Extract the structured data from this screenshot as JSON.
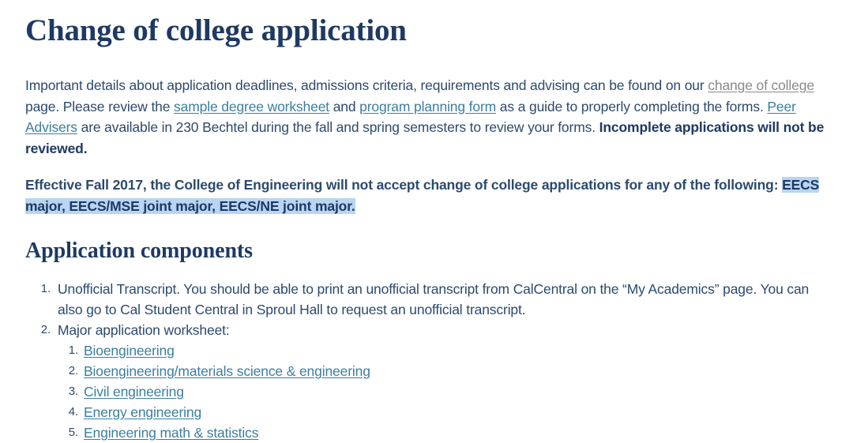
{
  "page": {
    "title": "Change of college application",
    "section_heading": "Application components"
  },
  "intro": {
    "part1": "Important details about application deadlines, admissions criteria, requirements and advising can be found on our ",
    "link_change_of_college": "change of college",
    "part2": " page. Please review the ",
    "link_sample_worksheet": "sample degree worksheet",
    "part3": " and ",
    "link_program_planning": "program planning form",
    "part4": " as a guide to properly completing the forms. ",
    "link_peer_advisers": "Peer Advisers",
    "part5": " are available in 230 Bechtel during the fall and spring semesters to review your forms. ",
    "bold_tail": "Incomplete applications will not be reviewed."
  },
  "notice": {
    "text_plain": "Effective Fall 2017, the College of Engineering will not accept change of college applications for any of the following: ",
    "text_highlighted": "EECS major, EECS/MSE joint major, EECS/NE joint major.",
    "highlight_color": "#b9d5f2"
  },
  "components": [
    {
      "text": "Unofficial Transcript. You should be able to print an unofficial transcript from CalCentral on the “My Academics” page.  You can also go to Cal Student Central in Sproul Hall to request an unofficial transcript."
    },
    {
      "text": "Major application worksheet:"
    }
  ],
  "majors": [
    {
      "label": "Bioengineering "
    },
    {
      "label": "Bioengineering/materials science & engineering"
    },
    {
      "label": "Civil engineering"
    },
    {
      "label": "Energy engineering"
    },
    {
      "label": "Engineering math & statistics"
    }
  ],
  "colors": {
    "heading": "#1e3a63",
    "body": "#2c4a6e",
    "link": "#3b7ea1",
    "link_visited": "#8a8a8a",
    "highlight": "#b9d5f2",
    "background": "#ffffff"
  }
}
